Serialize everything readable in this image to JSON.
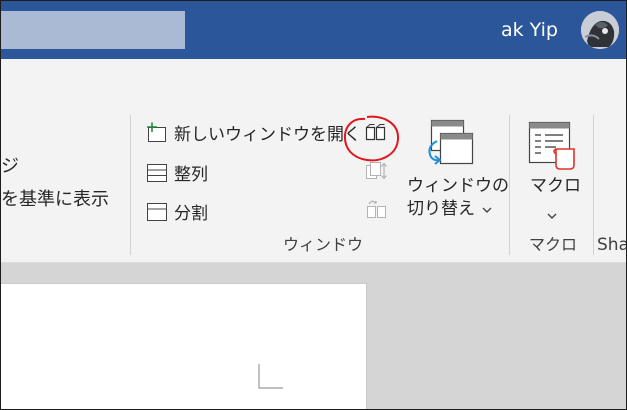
{
  "titlebar": {
    "user_name": "ak Yip",
    "avatar_icon": "user-avatar",
    "bg_color": "#2b579a"
  },
  "ribbon": {
    "left_partial": {
      "item1": "ジ",
      "item2": "を基準に表示"
    },
    "window_group": {
      "new_window": "新しいウィンドウを開く",
      "arrange": "整列",
      "split": "分割",
      "switch_line1": "ウィンドウの",
      "switch_line2": "切り替え",
      "label": "ウィンドウ"
    },
    "macro_group": {
      "button": "マクロ",
      "label": "マクロ"
    },
    "next_group_partial": "Sha"
  },
  "annotation": {
    "circle_color": "#e0161e"
  }
}
